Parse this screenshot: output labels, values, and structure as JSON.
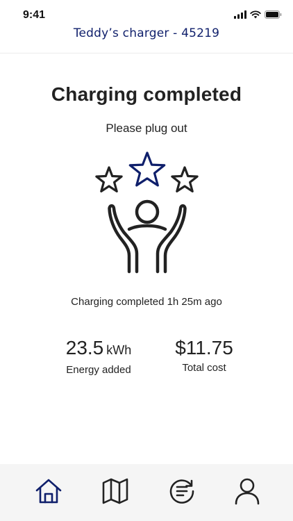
{
  "status_bar": {
    "time": "9:41"
  },
  "header": {
    "title": "Teddy’s charger - 45219"
  },
  "main": {
    "title": "Charging completed",
    "subtitle": "Please plug out",
    "completed_note": "Charging completed 1h 25m ago"
  },
  "stats": {
    "energy": {
      "value": "23.5",
      "unit": "kWh",
      "label": "Energy added"
    },
    "cost": {
      "value": "$11.75",
      "label": "Total cost"
    }
  },
  "icons": {
    "illustration": "celebrating-person-with-stars",
    "nav": [
      "home-icon",
      "map-icon",
      "history-icon",
      "profile-icon"
    ]
  },
  "colors": {
    "accent": "#0f1f6b",
    "text": "#222222",
    "nav_background": "#f5f5f5"
  }
}
